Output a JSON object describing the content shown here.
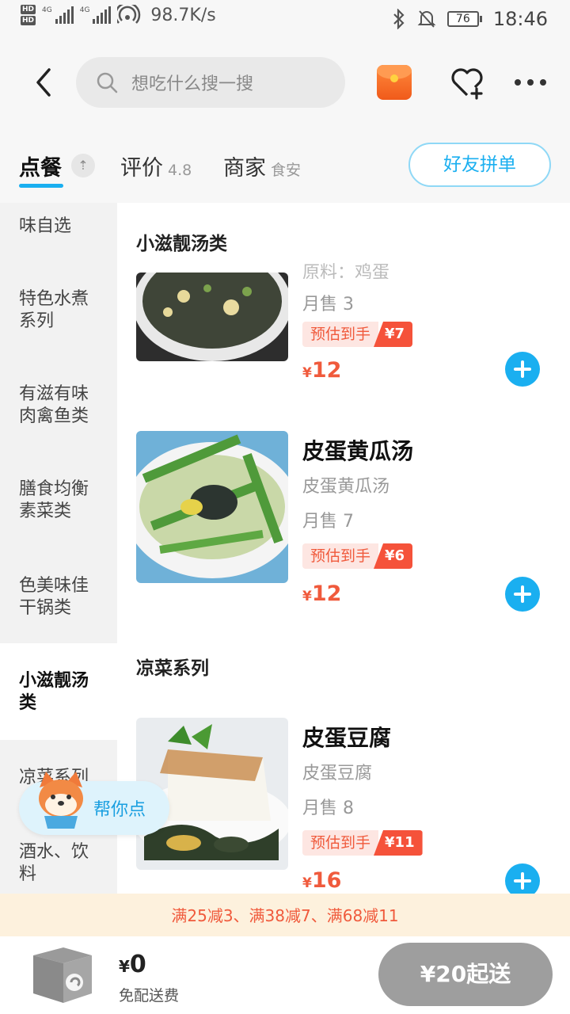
{
  "status_bar": {
    "hd1": "HD",
    "hd2": "HD",
    "net1": "4G",
    "net2": "4G",
    "speed": "98.7K/s",
    "battery": "76",
    "time": "18:46"
  },
  "header": {
    "search_placeholder": "想吃什么搜一搜"
  },
  "tabs": [
    {
      "label": "点餐",
      "sub": ""
    },
    {
      "label": "评价",
      "sub": "4.8"
    },
    {
      "label": "商家",
      "sub": "食安"
    }
  ],
  "group_order_label": "好友拼单",
  "sidebar": {
    "items": [
      {
        "label": "味自选"
      },
      {
        "label": "特色水煮系列"
      },
      {
        "label": "有滋有味肉禽鱼类"
      },
      {
        "label": "膳食均衡素菜类"
      },
      {
        "label": "色美味佳干锅类"
      },
      {
        "label": "小滋靓汤类"
      },
      {
        "label": "凉菜系列"
      },
      {
        "label": "酒水、饮料"
      }
    ]
  },
  "sections": [
    {
      "title": "小滋靓汤类"
    },
    {
      "title": "凉菜系列"
    }
  ],
  "items": [
    {
      "name": "",
      "desc": "原料：鸡蛋",
      "sales": "月售 3",
      "promo_label": "预估到手",
      "promo_value": "¥7",
      "price_symbol": "¥",
      "price": "12"
    },
    {
      "name": "皮蛋黄瓜汤",
      "desc": "皮蛋黄瓜汤",
      "sales": "月售 7",
      "promo_label": "预估到手",
      "promo_value": "¥6",
      "price_symbol": "¥",
      "price": "12"
    },
    {
      "name": "皮蛋豆腐",
      "desc": "皮蛋豆腐",
      "sales": "月售 8",
      "promo_label": "预估到手",
      "promo_value": "¥11",
      "price_symbol": "¥",
      "price": "16"
    }
  ],
  "helper_label": "帮你点",
  "discount_text": "满25减3、满38减7、满68减11",
  "bottom": {
    "total_symbol": "¥",
    "total": "0",
    "fee": "免配送费",
    "submit": "¥20起送"
  },
  "colors": {
    "accent": "#1aaff0",
    "price": "#f05a3c",
    "promo_bg": "#f5523a",
    "discount_bg": "#fdf1dd"
  }
}
